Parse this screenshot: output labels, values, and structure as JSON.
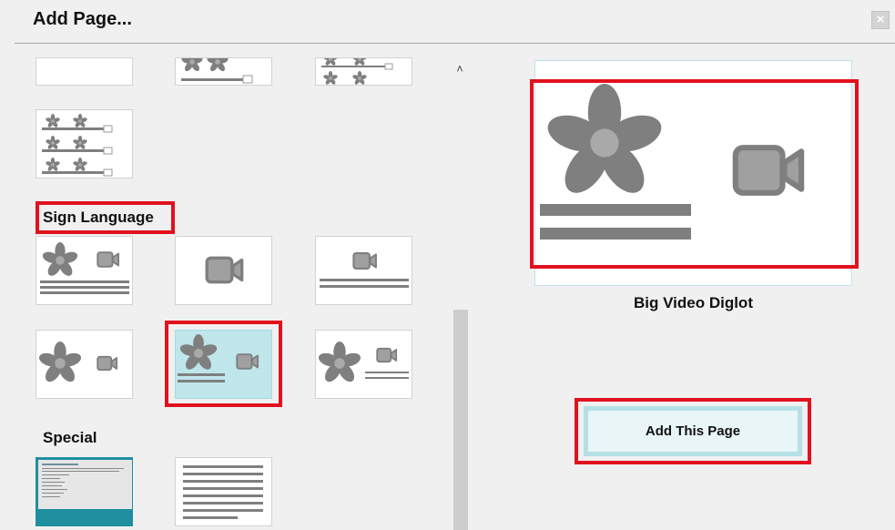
{
  "dialog": {
    "title": "Add Page...",
    "close_icon": "close-icon"
  },
  "sections": {
    "sign_language": "Sign Language",
    "special": "Special"
  },
  "preview": {
    "name": "Big Video Diglot",
    "add_button_label": "Add This Page"
  },
  "colors": {
    "highlight_red": "#e2111e",
    "selected_bg": "#bfe6ea",
    "shape_gray": "#7f7f7f"
  }
}
